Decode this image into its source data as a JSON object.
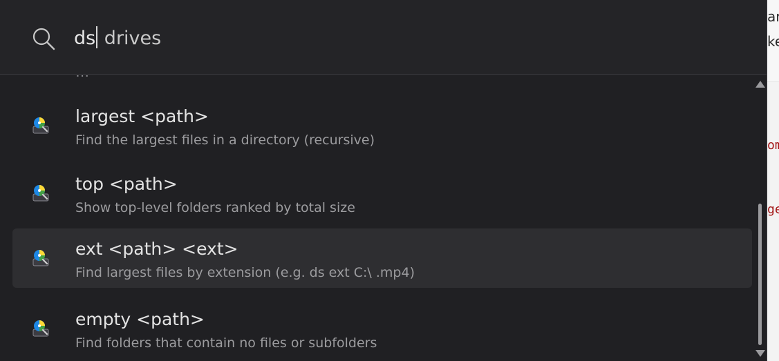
{
  "search": {
    "typed": "ds",
    "suggestion": " drives"
  },
  "results": [
    {
      "title": "largest <path>",
      "subtitle": "Find the largest files in a directory (recursive)",
      "selected": false
    },
    {
      "title": "top <path>",
      "subtitle": "Show top-level folders ranked by total size",
      "selected": false
    },
    {
      "title": "ext <path> <ext>",
      "subtitle": "Find largest files by extension (e.g. ds ext C:\\ .mp4)",
      "selected": true
    },
    {
      "title": "empty <path>",
      "subtitle": "Find folders that contain no files or subfolders",
      "selected": false
    }
  ],
  "background_window": {
    "fragments": [
      "ar",
      "ke",
      "om",
      "ge"
    ]
  },
  "colors": {
    "palette_bg": "#202023",
    "selected_row": "#2e2e31",
    "title_text": "#e3e3e3",
    "subtitle_text": "#9c9c9f"
  },
  "icons": {
    "search": "search-icon",
    "result": "disk-analyzer-icon"
  }
}
